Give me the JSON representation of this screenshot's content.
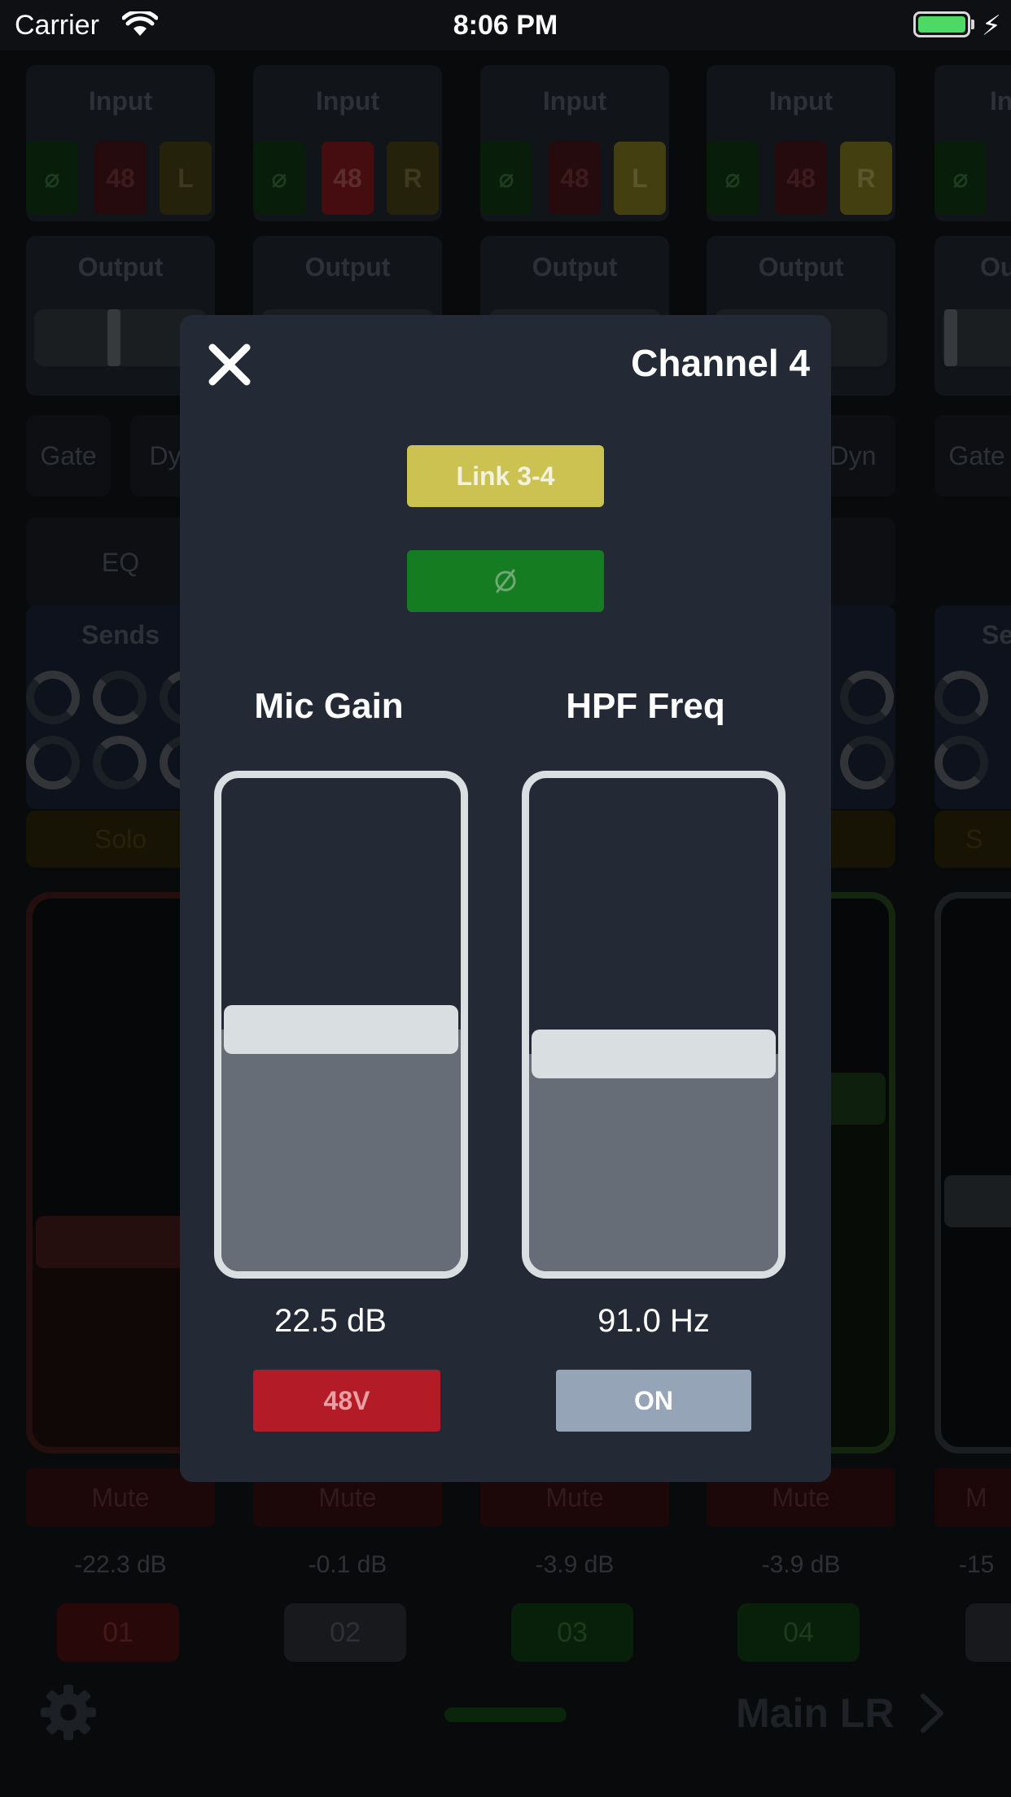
{
  "status_bar": {
    "carrier": "Carrier",
    "time": "8:06 PM",
    "battery_color": "#4cd964"
  },
  "strips": [
    {
      "input_label": "Input",
      "phase_symbol": "⌀",
      "phantom_label": "48",
      "side_label": "L",
      "output_label": "Output",
      "gate_label": "Gate",
      "dyn_label": "Dyn",
      "eq_label": "EQ",
      "sends_label": "Sends",
      "solo_label": "Solo",
      "mute_label": "Mute",
      "level": "-22.3 dB",
      "number": "01"
    },
    {
      "input_label": "Input",
      "phase_symbol": "⌀",
      "phantom_label": "48",
      "side_label": "R",
      "output_label": "Output",
      "mute_label": "Mute",
      "level": "-0.1 dB",
      "number": "02"
    },
    {
      "input_label": "Input",
      "phase_symbol": "⌀",
      "phantom_label": "48",
      "side_label": "L",
      "output_label": "Output",
      "mute_label": "Mute",
      "level": "-3.9 dB",
      "number": "03"
    },
    {
      "input_label": "Input",
      "phase_symbol": "⌀",
      "phantom_label": "48",
      "side_label": "R",
      "output_label": "Output",
      "dyn_label": "Dyn",
      "sends_label": "s",
      "mute_label": "Mute",
      "level": "-3.9 dB",
      "number": "04"
    },
    {
      "input_label": "In",
      "phase_symbol": "⌀",
      "output_label": "Ou",
      "gate_label": "Gate",
      "sends_label": "Se",
      "solo_label": "S",
      "mute_label": "M",
      "level": "-15"
    }
  ],
  "bottom_bar": {
    "main_label": "Main LR"
  },
  "modal": {
    "title": "Channel 4",
    "link_label": "Link 3-4",
    "mic_gain": {
      "label": "Mic Gain",
      "value": "22.5 dB",
      "level": 0.49,
      "phantom_label": "48V"
    },
    "hpf": {
      "label": "HPF Freq",
      "value": "91.0 Hz",
      "level": 0.44,
      "toggle_label": "ON"
    },
    "colors": {
      "link": "#cbc252",
      "phase": "#167c22",
      "phantom": "#b31b26",
      "hpf_toggle": "#96a4b7"
    }
  }
}
